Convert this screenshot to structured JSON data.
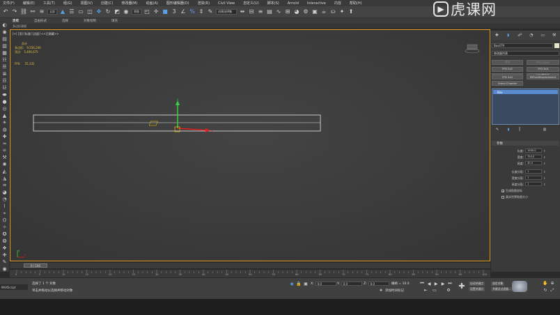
{
  "menu": [
    "文件(F)",
    "编辑(E)",
    "工具(T)",
    "组(G)",
    "视图(V)",
    "创建(C)",
    "修改器(M)",
    "动画(A)",
    "图形编辑器(D)",
    "渲染(R)",
    "Civil View",
    "自定义(U)",
    "脚本(S)",
    "Arnold",
    "Interactive",
    "内容",
    "帮助(H)"
  ],
  "toolbar": {
    "selection_filter": "全部",
    "ref_coord": "视图",
    "named_selection": "创建选择集"
  },
  "ribbon": {
    "tabs": [
      "建模",
      "自由形式",
      "选择",
      "对象绘制",
      "填充"
    ],
    "active_tab": "建模",
    "sub_label": "多边形建模"
  },
  "watermark": {
    "logo_text": "虎课网",
    "logo_glyph": "▶"
  },
  "viewport": {
    "label": "[+] [顶] [标准] [边面] <<已隐藏>>",
    "stats_title": "总计",
    "polys_label": "多边形:",
    "polys_value": "9,556,240",
    "verts_label": "顶点:",
    "verts_value": "5,466,675",
    "fps_label": "FPS:",
    "fps_value": "55.332",
    "axis_x": "x",
    "axis_y": "y",
    "gizmo_x": "x",
    "gizmo_y": "y"
  },
  "command_panel": {
    "object_name": "Box479",
    "modifier_list": "修改器列表",
    "buttons": [
      "挤出",
      "FFD 2x2x2",
      "FFD 2x2",
      "FFD 3x3",
      "FFD 4x4x4",
      "FFD(圆柱体)",
      "FFD 4x4",
      "MIFluidDisplacement",
      "Grand Chamfer"
    ],
    "stack_item": "Box",
    "params_title": "参数",
    "params": [
      {
        "label": "长度:",
        "value": "1000.0"
      },
      {
        "label": "宽度:",
        "value": "750.0"
      },
      {
        "label": "高度:",
        "value": "30.0"
      }
    ],
    "segments": [
      {
        "label": "长度分段:",
        "value": "1"
      },
      {
        "label": "宽度分段:",
        "value": "1"
      },
      {
        "label": "高度分段:",
        "value": "1"
      }
    ],
    "gen_uv": "生成贴图坐标",
    "real_world": "真实世界贴图大小"
  },
  "timeline": {
    "frame": "0 / 100",
    "ticks": [
      "0",
      "5",
      "10",
      "15",
      "20",
      "25",
      "30",
      "35",
      "40",
      "45",
      "50",
      "55",
      "60",
      "65",
      "70",
      "75",
      "80",
      "85",
      "90",
      "95",
      "100"
    ]
  },
  "status": {
    "maxscript": "MAXScript",
    "selected": "选择了 1 个 对象",
    "hint": "单击并拖动以选择并移动对象",
    "x_label": "X:",
    "x_value": "0.0",
    "y_label": "Y:",
    "y_value": "0.0",
    "z_label": "Z:",
    "z_value": "0.0",
    "grid": "栅格 = 10.0",
    "time_tag": "添加时间标记",
    "auto_key": "自动关键点",
    "selected_obj": "选定对象",
    "set_key": "设置关键点",
    "key_filter": "关键点过滤器..."
  }
}
